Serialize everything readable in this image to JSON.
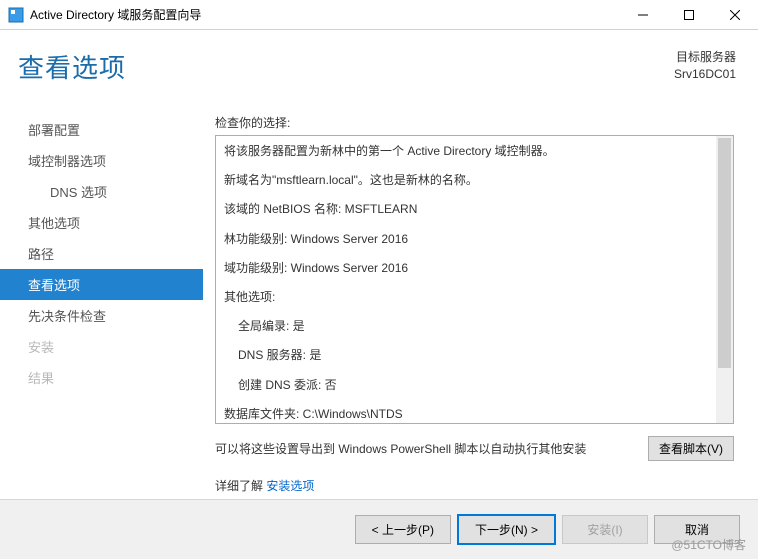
{
  "window": {
    "title": "Active Directory 域服务配置向导"
  },
  "header": {
    "heading": "查看选项",
    "target_label": "目标服务器",
    "target_server": "Srv16DC01"
  },
  "sidebar": {
    "items": [
      {
        "label": "部署配置"
      },
      {
        "label": "域控制器选项"
      },
      {
        "label": "DNS 选项"
      },
      {
        "label": "其他选项"
      },
      {
        "label": "路径"
      },
      {
        "label": "查看选项"
      },
      {
        "label": "先决条件检查"
      },
      {
        "label": "安装"
      },
      {
        "label": "结果"
      }
    ]
  },
  "content": {
    "review_label": "检查你的选择:",
    "lines": {
      "l0": "将该服务器配置为新林中的第一个 Active Directory 域控制器。",
      "l1": "新域名为\"msftlearn.local\"。这也是新林的名称。",
      "l2": "该域的 NetBIOS 名称: MSFTLEARN",
      "l3": "林功能级别: Windows Server 2016",
      "l4": "域功能级别: Windows Server 2016",
      "l5": "其他选项:",
      "l6": "全局编录: 是",
      "l7": "DNS 服务器: 是",
      "l8": "创建 DNS 委派: 否",
      "l9": "数据库文件夹: C:\\Windows\\NTDS"
    },
    "export_text": "可以将这些设置导出到 Windows PowerShell 脚本以自动执行其他安装",
    "view_script_btn": "查看脚本(V)",
    "more_link_prefix": "详细了解",
    "more_link_text": "安装选项"
  },
  "footer": {
    "prev": "< 上一步(P)",
    "next": "下一步(N) >",
    "install": "安装(I)",
    "cancel": "取消"
  },
  "watermark": "@51CTO博客"
}
